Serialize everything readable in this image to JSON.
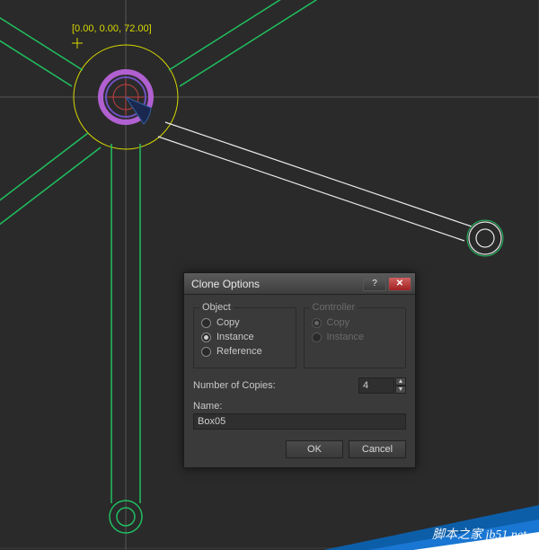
{
  "viewport": {
    "coord_label": "[0.00, 0.00, 72.00]"
  },
  "dialog": {
    "title": "Clone Options",
    "object_group": {
      "title": "Object",
      "copy": "Copy",
      "instance": "Instance",
      "reference": "Reference",
      "selected": "instance"
    },
    "controller_group": {
      "title": "Controller",
      "copy": "Copy",
      "instance": "Instance",
      "selected": "copy"
    },
    "copies_label": "Number of Copies:",
    "copies_value": "4",
    "name_label": "Name:",
    "name_value": "Box05",
    "ok": "OK",
    "cancel": "Cancel"
  },
  "watermark": {
    "site": "jb51.net",
    "cn": "脚本之家"
  }
}
